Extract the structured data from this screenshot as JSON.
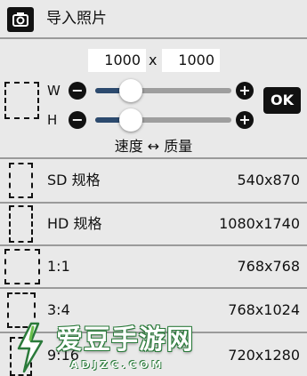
{
  "header": {
    "title": "导入照片",
    "icon": "camera-icon"
  },
  "size": {
    "width_value": "1000",
    "separator": "x",
    "height_value": "1000"
  },
  "sliders": {
    "w_label": "W",
    "h_label": "H",
    "minus": "−",
    "plus": "+",
    "w_level": 0.26,
    "h_level": 0.26
  },
  "ok_label": "OK",
  "speed_quality": "速度 ↔ 质量",
  "presets": [
    {
      "label": "SD 规格",
      "value": "540x870"
    },
    {
      "label": "HD 规格",
      "value": "1080x1740"
    },
    {
      "label": "1:1",
      "value": "768x768"
    },
    {
      "label": "3:4",
      "value": "768x1024"
    },
    {
      "label": "9:16",
      "value": "720x1280"
    }
  ],
  "watermark": {
    "text": "爱豆手游网",
    "sub": "ADJZC.COM"
  },
  "colors": {
    "slider_fill": "#2c4a6e",
    "button_bg": "#111111",
    "watermark_outline": "#2a7a3a"
  }
}
